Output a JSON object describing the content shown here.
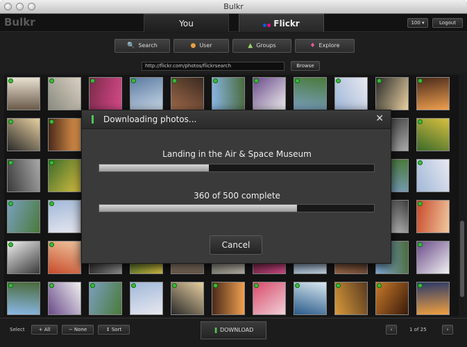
{
  "window": {
    "title": "Bulkr"
  },
  "header": {
    "logo": "Bulkr",
    "tabs": [
      {
        "label": "You",
        "active": false
      },
      {
        "label": "Flickr",
        "active": true
      }
    ],
    "count_select": "100 ▾",
    "logout_label": "Logout"
  },
  "toolbar": {
    "segments": [
      {
        "label": "Search",
        "icon": "magnifier-icon"
      },
      {
        "label": "User",
        "icon": "user-icon"
      },
      {
        "label": "Groups",
        "icon": "groups-icon"
      },
      {
        "label": "Explore",
        "icon": "explore-icon"
      }
    ],
    "url_value": "http://flickr.com/photos/flickrsearch",
    "browse_label": "Browse"
  },
  "bottom": {
    "select_label": "Select",
    "all_label": "+ All",
    "none_label": "− None",
    "sort_label": "↕ Sort",
    "download_label": "DOWNLOAD",
    "prev_label": "‹",
    "page_label": "1 of 25",
    "next_label": "›"
  },
  "dialog": {
    "title": "Downloading photos...",
    "current_file": "Landing in the Air & Space Museum",
    "file_progress": 0.4,
    "overall_text": "360 of 500 complete",
    "overall_progress": 0.72,
    "cancel_label": "Cancel"
  },
  "colors": {
    "background": "#1b1b1b",
    "check": "#3dbb3d",
    "flickr_blue": "#0063dc",
    "flickr_pink": "#ff0084"
  }
}
